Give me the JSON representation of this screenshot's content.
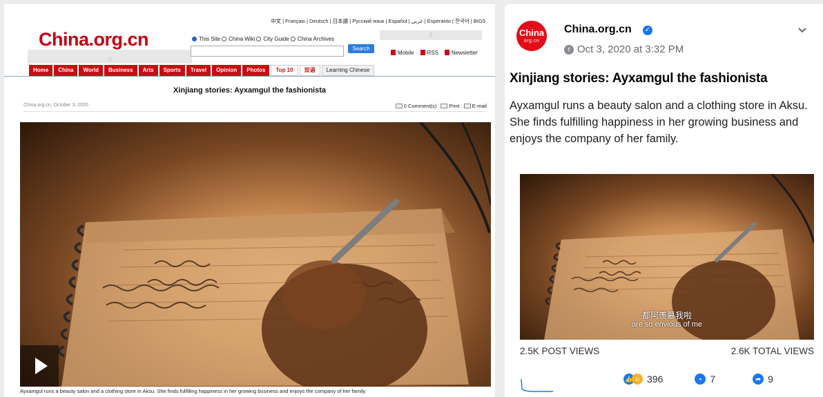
{
  "left_page": {
    "language_bar": "中文 | Français | Deutsch | 日本語 | Русский язык | Español | عربي | Esperanto | 한국어 | BIG5",
    "logo": "China.org.cn",
    "search_options": [
      "This Site",
      "China Wiki",
      "City Guide",
      "China Archives"
    ],
    "search_button": "Search",
    "feed_links": [
      "Mobile",
      "RSS",
      "Newsletter"
    ],
    "nav_items": [
      "Home",
      "China",
      "World",
      "Business",
      "Arts",
      "Sports",
      "Travel",
      "Opinion",
      "Photos"
    ],
    "nav_special": [
      "Top 10",
      "双语"
    ],
    "nav_extra": "Learning Chinese",
    "article_title": "Xinjiang stories: Ayxamgul the fashionista",
    "byline": "China.org.cn, October 3, 2020",
    "tools": [
      "0 Comment(s)",
      "Print",
      "E-mail"
    ],
    "caption": "Ayxamgul runs a beauty salon and a clothing store in Aksu.  She finds fulfilling happiness in her growing business and enjoys the company of her family."
  },
  "fb_post": {
    "avatar_text": "China",
    "avatar_sub": "org.cn",
    "page_name": "China.org.cn",
    "timestamp": "Oct 3, 2020 at 3:32 PM",
    "title": "Xinjiang stories: Ayxamgul the fashionista",
    "description": "Ayxamgul runs a beauty salon and a clothing store in Aksu. She finds fulfilling happiness in her growing business and enjoys the company of her family.",
    "subtitle_cn": "都阿羡慕我啦",
    "subtitle_en": "are so envious of me",
    "post_views": "2.5K POST VIEWS",
    "total_views": "2.6K TOTAL VIEWS",
    "reactions": "396",
    "comments": "7",
    "shares": "9"
  },
  "colors": {
    "china_red": "#c60f13",
    "fb_blue": "#1877f2"
  },
  "icons": [
    "play-icon",
    "verified-icon",
    "globe-icon",
    "chevron-down-icon",
    "comment-icon",
    "share-icon",
    "like-icon"
  ]
}
